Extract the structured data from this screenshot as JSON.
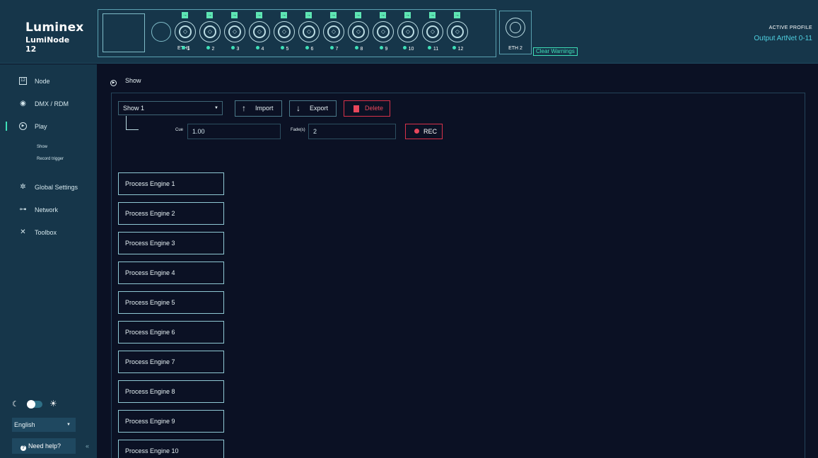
{
  "brand": {
    "name": "Luminex",
    "product": "LumiNode 12"
  },
  "device": {
    "eth1_label": "ETH1",
    "ports": [
      {
        "label": "1"
      },
      {
        "label": "2"
      },
      {
        "label": "3"
      },
      {
        "label": "4"
      },
      {
        "label": "5"
      },
      {
        "label": "6"
      },
      {
        "label": "7"
      },
      {
        "label": "8"
      },
      {
        "label": "9"
      },
      {
        "label": "10"
      },
      {
        "label": "11"
      },
      {
        "label": "12"
      }
    ],
    "eth2_label": "ETH 2",
    "clear_warnings": "Clear Warnings"
  },
  "profile": {
    "title": "ACTIVE PROFILE",
    "value": "Output ArtNet 0-11"
  },
  "sidebar": {
    "items": [
      {
        "label": "Node",
        "icon": "node-12-icon"
      },
      {
        "label": "DMX / RDM",
        "icon": "dmx-target-icon"
      },
      {
        "label": "Play",
        "icon": "play-circle-icon"
      },
      {
        "label": "Global Settings",
        "icon": "gear-icon"
      },
      {
        "label": "Network",
        "icon": "network-icon"
      },
      {
        "label": "Toolbox",
        "icon": "tools-icon"
      }
    ],
    "sub_items": [
      "Show",
      "Record trigger"
    ],
    "language": "English",
    "help": "Need help?",
    "collapse": "«"
  },
  "main": {
    "breadcrumb": "Show",
    "show_select": "Show 1",
    "import_label": "Import",
    "export_label": "Export",
    "delete_label": "Delete",
    "cue_label": "Cue",
    "cue_value": "1.00",
    "fade_label": "Fade(s)",
    "fade_value": "2",
    "rec_label": "REC",
    "engines": [
      "Process Engine 1",
      "Process Engine 2",
      "Process Engine 3",
      "Process Engine 4",
      "Process Engine 5",
      "Process Engine 6",
      "Process Engine 7",
      "Process Engine 8",
      "Process Engine 9",
      "Process Engine 10"
    ]
  },
  "colors": {
    "accent": "#3ee0b8",
    "danger": "#e8475c",
    "header_bg": "#16364a",
    "page_bg": "#0b1124"
  }
}
